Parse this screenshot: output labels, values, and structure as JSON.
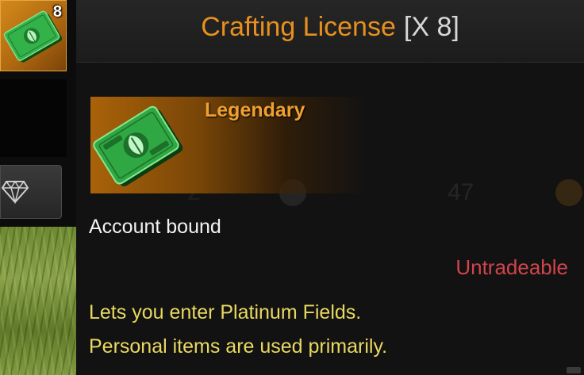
{
  "slot": {
    "count": "8",
    "icon": "crafting-license-icon"
  },
  "item": {
    "name": "Crafting License",
    "quantity": "[X 8]",
    "rarity": "Legendary",
    "binding": "Account bound",
    "trade_status": "Untradeable",
    "description": [
      "Lets you enter Platinum Fields.",
      "Personal items are used primarily."
    ]
  },
  "colors": {
    "title": "#e8901e",
    "rarity": "#f0a030",
    "untradeable": "#d0454c",
    "description": "#e9d860"
  },
  "icons": [
    "crafting-license-icon",
    "gem-icon"
  ]
}
